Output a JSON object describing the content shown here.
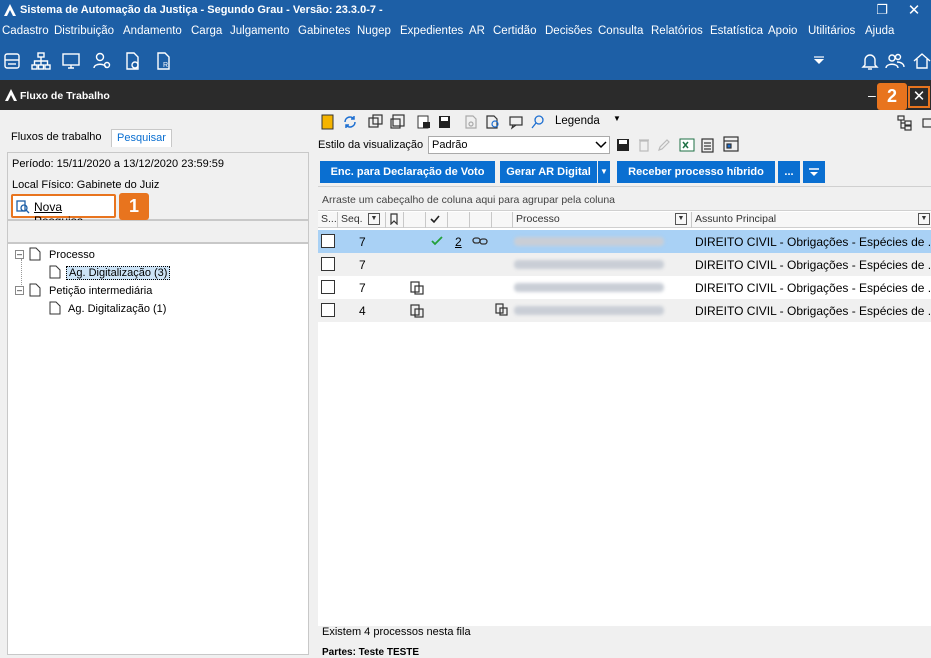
{
  "window": {
    "title": "Sistema de Automação da Justiça - Segundo Grau - Versão: 23.3.0-7 -",
    "restore_glyph": "❐",
    "close_glyph": "✕"
  },
  "menu": [
    "Cadastro",
    "Distribuição",
    "Andamento",
    "Carga",
    "Julgamento",
    "Gabinetes",
    "Nugep",
    "Expedientes",
    "AR",
    "Certidão",
    "Decisões",
    "Consulta",
    "Relatórios",
    "Estatística",
    "Apoio",
    "Utilitários",
    "Ajuda"
  ],
  "child_window": {
    "title": "Fluxo de Trabalho",
    "minimize_glyph": "–",
    "close_glyph": "✕"
  },
  "left": {
    "tabs": [
      "Fluxos de trabalho",
      "Pesquisar"
    ],
    "periodo": "Período: 15/11/2020 a 13/12/2020 23:59:59",
    "local": "Local Físico: Gabinete do Juiz",
    "nova_pesquisa": "Nova Pesquisa",
    "tree": {
      "processo": "Processo",
      "processo_child": "Ag. Digitalização (3)",
      "peticao": "Petição intermediária",
      "peticao_child": "Ag. Digitalização (1)"
    }
  },
  "badges": {
    "one": "1",
    "two": "2"
  },
  "right": {
    "legenda": "Legenda",
    "estilo_label": "Estilo da visualização",
    "estilo_value": "Padrão",
    "buttons": {
      "enc": "Enc. para Declaração de Voto",
      "gerar": "Gerar AR Digital",
      "receber": "Receber processo híbrido",
      "more": "..."
    },
    "grid": {
      "group_hint": "Arraste um cabeçalho de coluna aqui para agrupar pela coluna",
      "headers": {
        "s": "S...",
        "seq": "Seq.",
        "processo": "Processo",
        "assunto": "Assunto Principal"
      },
      "rows": [
        {
          "seq": "7",
          "link": "2",
          "assunto": "DIREITO CIVIL - Obrigações - Espécies de ..."
        },
        {
          "seq": "7",
          "assunto": "DIREITO CIVIL - Obrigações - Espécies de ..."
        },
        {
          "seq": "7",
          "assunto": "DIREITO CIVIL - Obrigações - Espécies de ..."
        },
        {
          "seq": "4",
          "assunto": "DIREITO CIVIL - Obrigações - Espécies de ..."
        }
      ]
    },
    "status": "Existem 4 processos nesta fila",
    "partes": "Partes: Teste TESTE"
  }
}
